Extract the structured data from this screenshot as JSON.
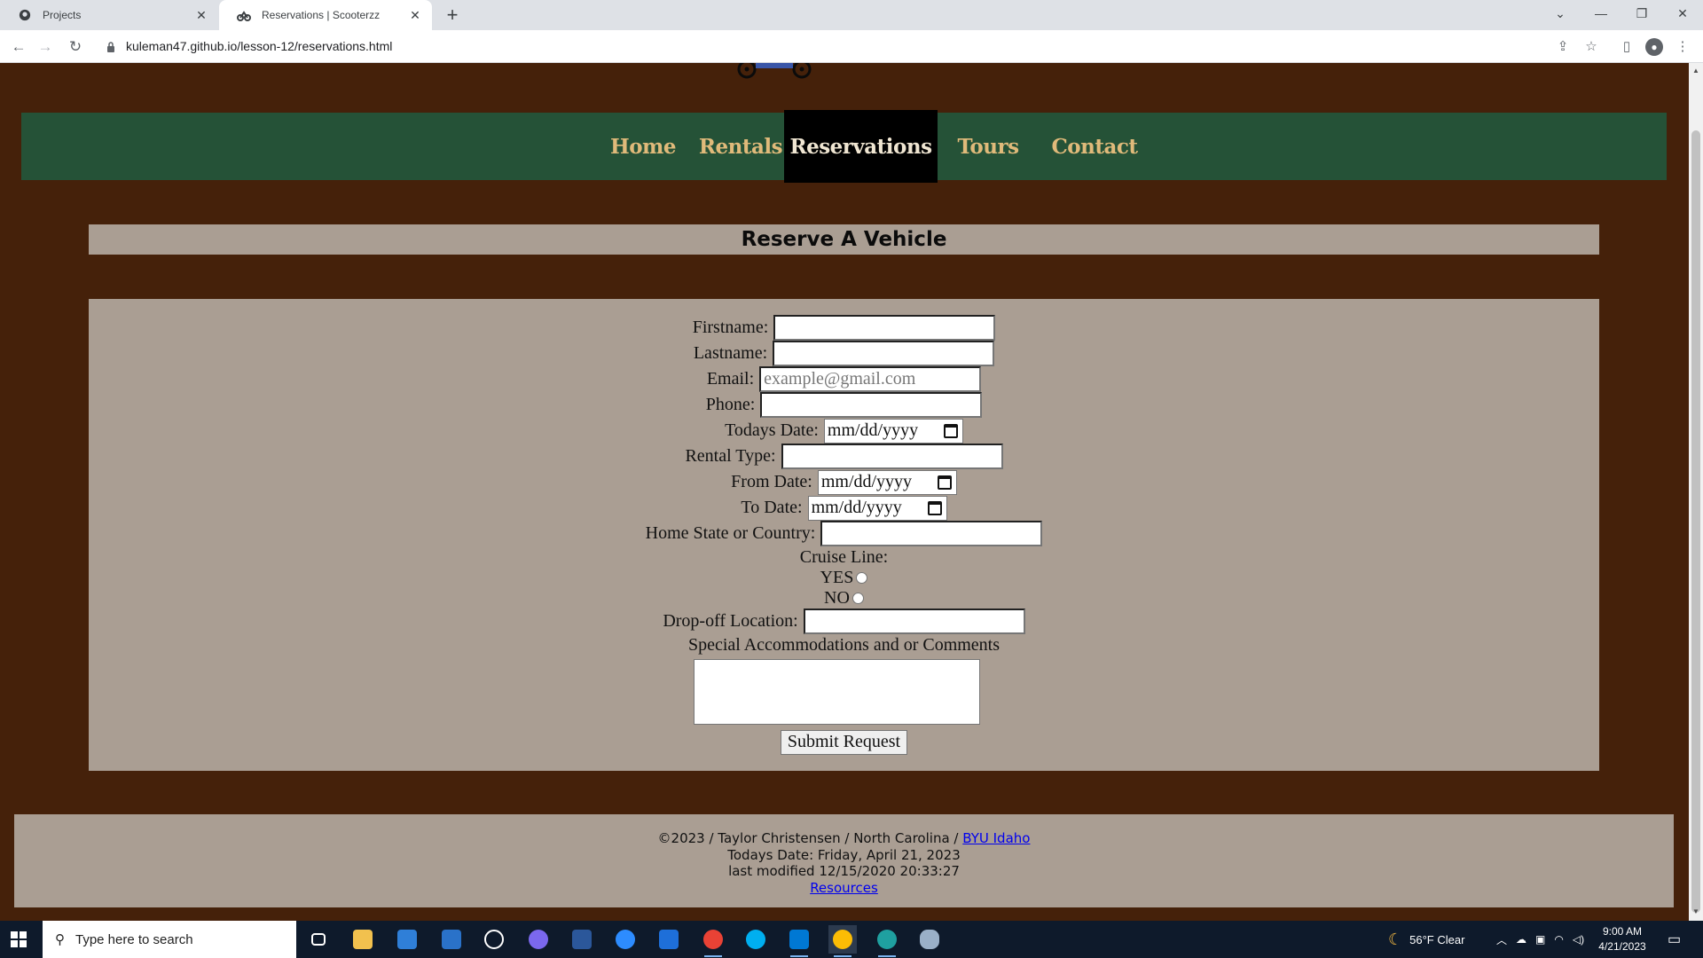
{
  "browser": {
    "tabs": [
      {
        "title": "Projects",
        "active": false
      },
      {
        "title": "Reservations | Scooterzz",
        "active": true
      }
    ],
    "url": "kuleman47.github.io/lesson-12/reservations.html"
  },
  "nav": {
    "items": [
      "Home",
      "Rentals",
      "Reservations",
      "Tours",
      "Contact"
    ],
    "active": "Reservations"
  },
  "page": {
    "title": "Reserve A Vehicle"
  },
  "form": {
    "firstname_label": "Firstname:",
    "lastname_label": "Lastname:",
    "email_label": "Email:",
    "email_placeholder": "example@gmail.com",
    "phone_label": "Phone:",
    "todays_date_label": "Todays Date:",
    "date_placeholder": "mm/dd/yyyy",
    "rental_type_label": "Rental Type:",
    "from_date_label": "From Date:",
    "to_date_label": "To Date:",
    "home_state_label": "Home State or Country:",
    "cruise_line_label": "Cruise Line:",
    "yes_label": "YES",
    "no_label": "NO",
    "dropoff_label": "Drop-off Location:",
    "comments_label": "Special Accommodations and or Comments",
    "submit_label": "Submit Request"
  },
  "footer": {
    "copyright_prefix": "©2023 / Taylor Christensen / North Carolina / ",
    "school_link": "BYU Idaho",
    "todays_date": "Todays Date: Friday, April 21, 2023",
    "last_modified": "last modified 12/15/2020 20:33:27",
    "resources_link": "Resources"
  },
  "taskbar": {
    "search_placeholder": "Type here to search",
    "weather": "56°F  Clear",
    "time": "9:00 AM",
    "date": "4/21/2023"
  },
  "colors": {
    "page_bg": "#45210a",
    "nav_bg": "#255237",
    "nav_text": "#e0ba7a",
    "panel_bg": "#aa9e93"
  }
}
